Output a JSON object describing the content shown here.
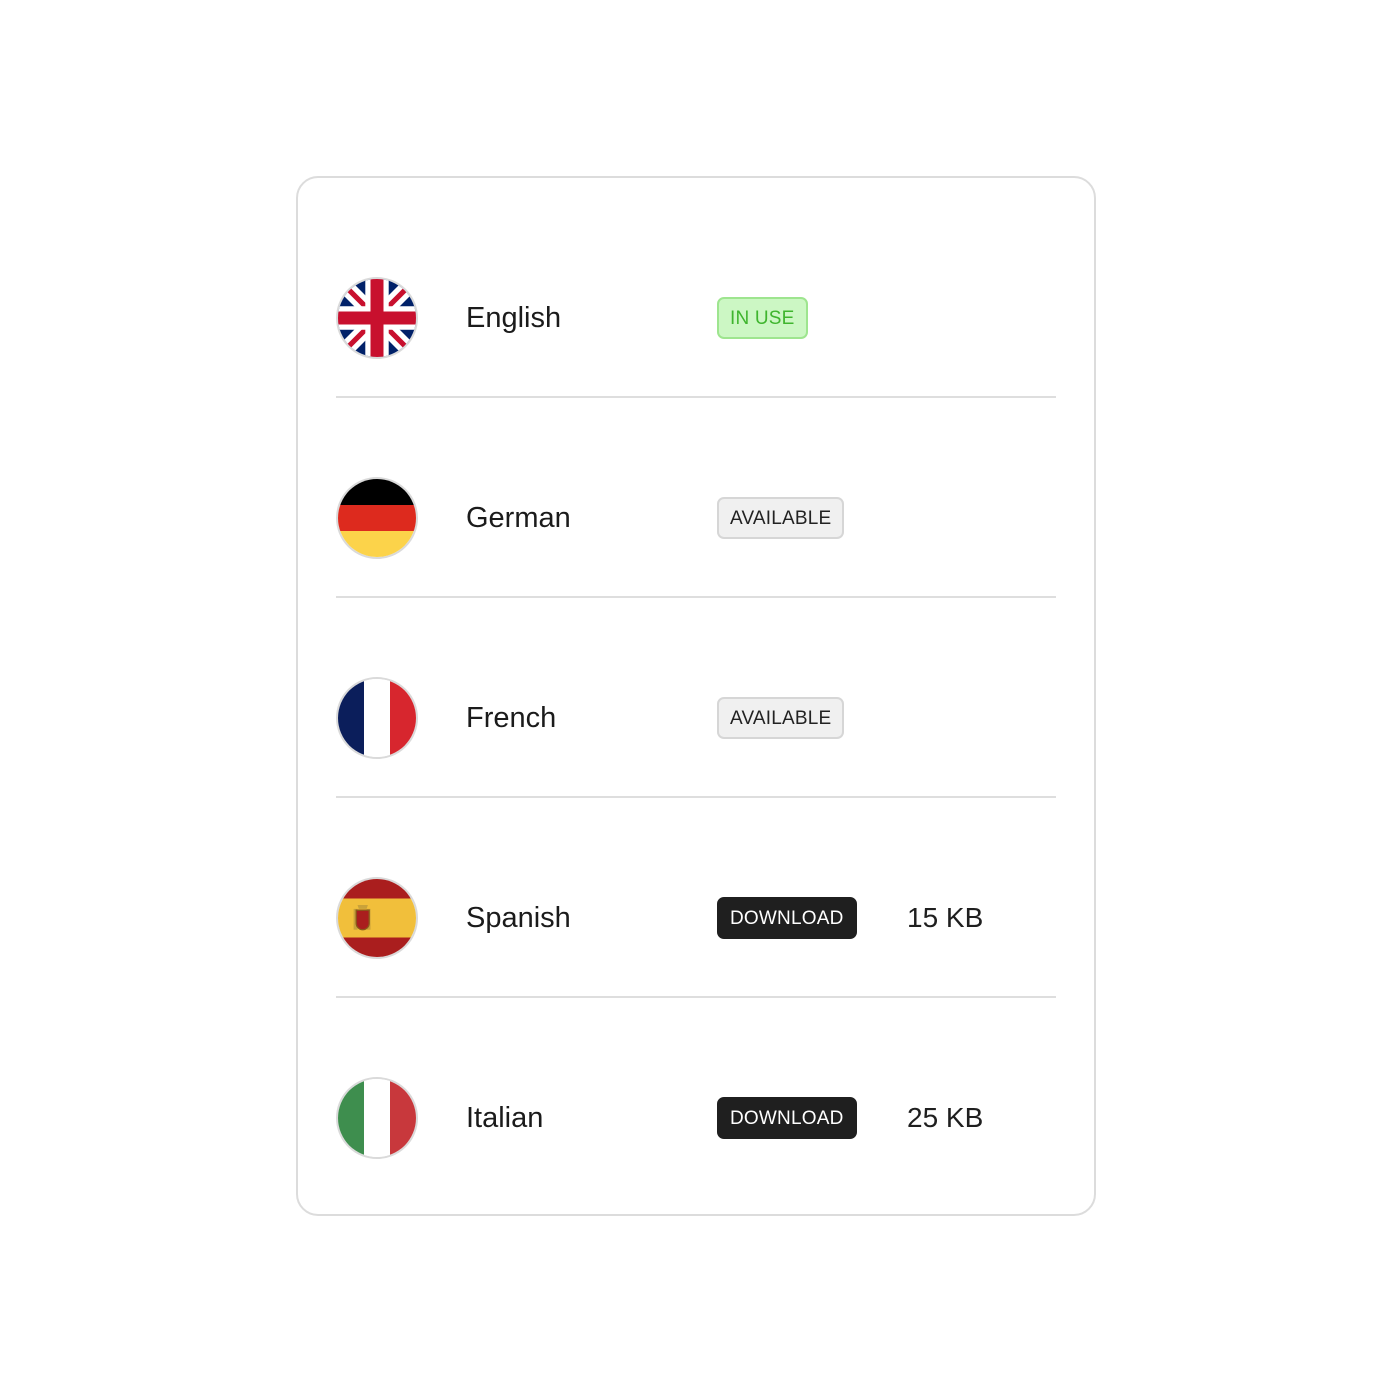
{
  "languages": [
    {
      "name": "English",
      "flag": "uk-flag-icon",
      "status": "IN USE",
      "status_type": "in-use",
      "size": ""
    },
    {
      "name": "German",
      "flag": "germany-flag-icon",
      "status": "AVAILABLE",
      "status_type": "available",
      "size": ""
    },
    {
      "name": "French",
      "flag": "france-flag-icon",
      "status": "AVAILABLE",
      "status_type": "available",
      "size": ""
    },
    {
      "name": "Spanish",
      "flag": "spain-flag-icon",
      "status": "DOWNLOAD",
      "status_type": "download",
      "size": "15 KB"
    },
    {
      "name": "Italian",
      "flag": "italy-flag-icon",
      "status": "DOWNLOAD",
      "status_type": "download",
      "size": "25 KB"
    }
  ],
  "colors": {
    "in_use_bg": "#ccf7c4",
    "in_use_text": "#3fb52e",
    "download_bg": "#1f1f1f",
    "available_bg": "#f0f0f0"
  }
}
